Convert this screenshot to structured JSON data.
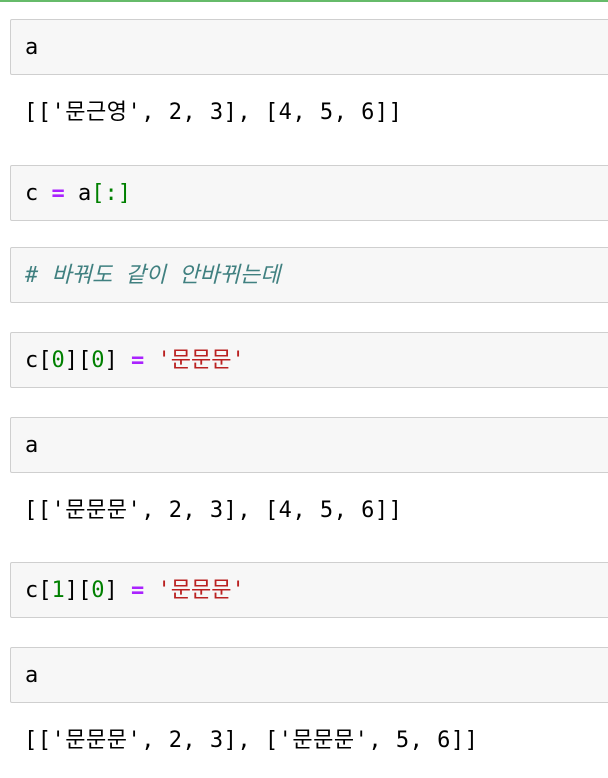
{
  "cells": [
    {
      "input": {
        "parts": [
          {
            "t": "a"
          }
        ]
      },
      "output": "[['문근영', 2, 3], [4, 5, 6]]"
    },
    {
      "input": {
        "parts": [
          {
            "t": "c"
          },
          {
            "t": " "
          },
          {
            "t": "="
          },
          {
            "t": " a"
          },
          {
            "t": "[:]"
          }
        ]
      }
    },
    {
      "input": {
        "comment": "# 바꿔도 같이 안바뀌는데"
      }
    },
    {
      "input": {
        "parts": [
          {
            "t": "c["
          },
          {
            "t": "0"
          },
          {
            "t": "]["
          },
          {
            "t": "0"
          },
          {
            "t": "]"
          },
          {
            "t": " = "
          },
          {
            "t": "'문문문'"
          }
        ]
      }
    },
    {
      "input": {
        "parts": [
          {
            "t": "a"
          }
        ]
      },
      "output": "[['문문문', 2, 3], [4, 5, 6]]"
    },
    {
      "input": {
        "parts": [
          {
            "t": "c["
          },
          {
            "t": "1"
          },
          {
            "t": "]["
          },
          {
            "t": "0"
          },
          {
            "t": "]"
          },
          {
            "t": " = "
          },
          {
            "t": "'문문문'"
          }
        ]
      }
    },
    {
      "input": {
        "parts": [
          {
            "t": "a"
          }
        ]
      },
      "output": "[['문문문', 2, 3], ['문문문', 5, 6]]"
    }
  ],
  "colors": {
    "top_border": "#66bb6a",
    "cell_bg": "#f7f7f7",
    "cell_border": "#cfcfcf",
    "operator": "#aa22ff",
    "number": "#008000",
    "string": "#ba2121",
    "comment": "#408080"
  }
}
